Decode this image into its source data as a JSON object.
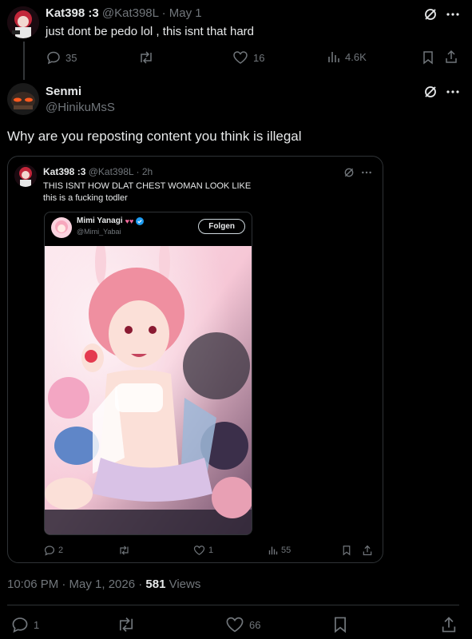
{
  "parent_post": {
    "name": "Kat398 :3",
    "handle": "@Kat398L",
    "date": "May 1",
    "text": "just dont be pedo lol , this isnt that hard",
    "replies": "35",
    "likes": "16",
    "views": "4.6K"
  },
  "main_post": {
    "name": "Senmi",
    "handle": "@HinikuMsS",
    "text": "Why are you reposting content you think is illegal",
    "timestamp": "10:06 PM · May 1, 2026 · ",
    "views_count": "581",
    "views_label": " Views",
    "replies": "1",
    "likes": "66"
  },
  "quoted_post": {
    "name": "Kat398 :3",
    "handle": "@Kat398L",
    "time": "2h",
    "line1": "THIS ISNT HOW DLAT CHEST WOMAN LOOK LIKE",
    "line2": "this is a fucking todler",
    "replies": "2",
    "likes": "1",
    "views": "55"
  },
  "embedded_post": {
    "name": "Mimi Yanagi",
    "handle": "@Mimi_Yabai",
    "follow_label": "Folgen"
  },
  "icons": [
    "grok-icon",
    "more-icon",
    "reply-icon",
    "repost-icon",
    "like-icon",
    "views-icon",
    "bookmark-icon",
    "share-icon",
    "verified-icon"
  ],
  "colors": {
    "background": "#000000",
    "text": "#e7e9ea",
    "muted": "#71767b",
    "border": "#2f3336",
    "verified": "#1d9bf0"
  }
}
